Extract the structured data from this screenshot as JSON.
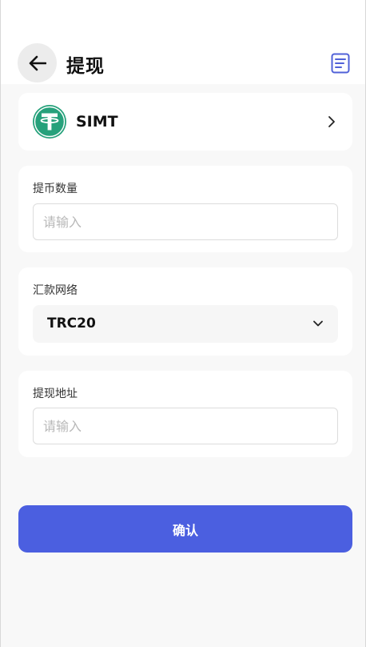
{
  "header": {
    "title": "提现"
  },
  "coin": {
    "name": "SIMT",
    "icon": "tether-icon",
    "brand_color": "#26a17b"
  },
  "amount": {
    "label": "提币数量",
    "placeholder": "请输入",
    "value": ""
  },
  "network": {
    "label": "汇款网络",
    "selected": "TRC20"
  },
  "address": {
    "label": "提现地址",
    "placeholder": "请输入",
    "value": ""
  },
  "actions": {
    "confirm_label": "确认"
  },
  "colors": {
    "accent": "#4b5fe0",
    "icon_accent": "#5061d8",
    "background": "#f8f8f8"
  }
}
